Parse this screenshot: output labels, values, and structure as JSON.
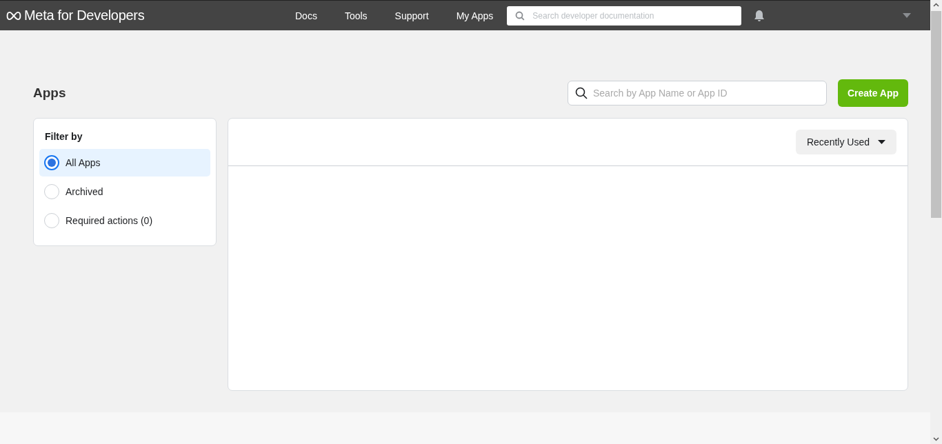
{
  "navbar": {
    "brand": "Meta for Developers",
    "links": [
      "Docs",
      "Tools",
      "Support",
      "My Apps"
    ],
    "search": {
      "placeholder": "Search developer documentation"
    }
  },
  "page": {
    "title": "Apps",
    "search": {
      "placeholder": "Search by App Name or App ID"
    },
    "create_button": "Create App"
  },
  "filter": {
    "title": "Filter by",
    "options": [
      {
        "label": "All Apps",
        "selected": true
      },
      {
        "label": "Archived",
        "selected": false
      },
      {
        "label": "Required actions (0)",
        "selected": false
      }
    ]
  },
  "sort": {
    "label": "Recently Used"
  }
}
